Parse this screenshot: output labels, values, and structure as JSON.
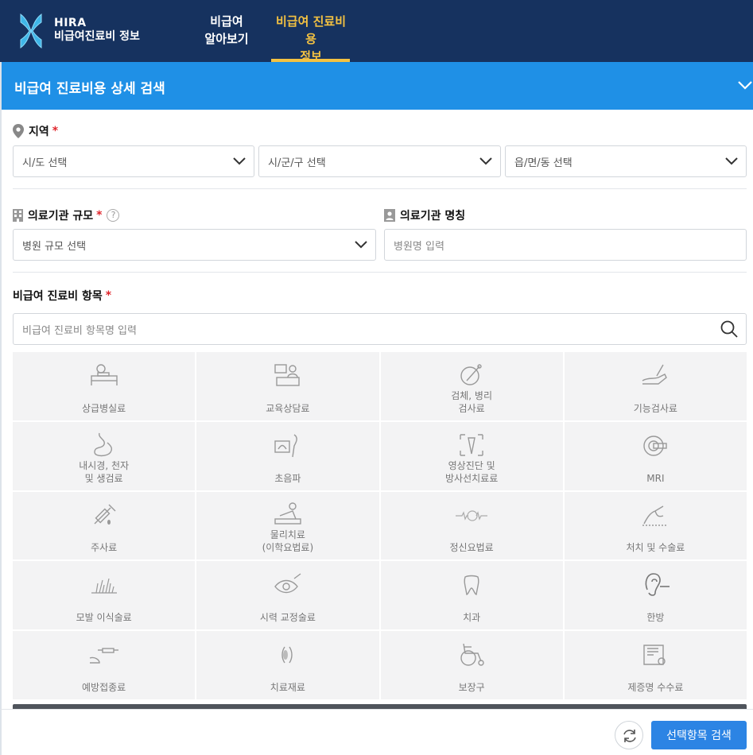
{
  "header": {
    "logo_line1": "HIRA",
    "logo_line2": "비급여진료비 정보",
    "nav": [
      {
        "label_line1": "비급여",
        "label_line2": "알아보기"
      },
      {
        "label_line1": "비급여 진료비용",
        "label_line2": "정보",
        "active": true
      }
    ]
  },
  "section": {
    "title": "비급여 진료비용 상세 검색",
    "icon": "chevron-down-icon"
  },
  "region": {
    "label": "지역",
    "required_mark": "*",
    "icon": "map-pin-icon",
    "selects": [
      "시/도 선택",
      "시/군/구 선택",
      "읍/면/동 선택"
    ]
  },
  "hospital_scale": {
    "label": "의료기관 규모",
    "required_mark": "*",
    "help": "?",
    "select": "병원 규모 선택"
  },
  "hospital_name": {
    "label": "의료기관 명칭",
    "placeholder": "병원명 입력"
  },
  "item_search": {
    "label": "비급여 진료비 항목",
    "required_mark": "*",
    "placeholder": "비급여 진료비 항목명 입력"
  },
  "categories": [
    {
      "label": "상급병실료",
      "icon": "hospital-bed-icon"
    },
    {
      "label": "교육상담료",
      "icon": "counseling-icon"
    },
    {
      "label": "검체, 병리\n검사료",
      "icon": "specimen-test-icon"
    },
    {
      "label": "기능검사료",
      "icon": "function-test-icon"
    },
    {
      "label": "내시경, 천자\n및 생검료",
      "icon": "endoscope-icon"
    },
    {
      "label": "초음파",
      "icon": "ultrasound-icon"
    },
    {
      "label": "영상진단 및\n방사선치료료",
      "icon": "xray-icon"
    },
    {
      "label": "MRI",
      "icon": "mri-icon"
    },
    {
      "label": "주사료",
      "icon": "syringe-icon"
    },
    {
      "label": "물리치료\n(이학요법료)",
      "icon": "physical-therapy-icon"
    },
    {
      "label": "정신요법료",
      "icon": "brain-wave-icon"
    },
    {
      "label": "처치 및 수술료",
      "icon": "surgery-icon"
    },
    {
      "label": "모발 이식술료",
      "icon": "hair-transplant-icon"
    },
    {
      "label": "시력 교정술료",
      "icon": "eye-laser-icon"
    },
    {
      "label": "치과",
      "icon": "tooth-icon"
    },
    {
      "label": "한방",
      "icon": "ear-acupuncture-icon"
    },
    {
      "label": "예방접종료",
      "icon": "vaccine-icon"
    },
    {
      "label": "치료재료",
      "icon": "medical-material-icon"
    },
    {
      "label": "보장구",
      "icon": "wheelchair-icon"
    },
    {
      "label": "제증명 수수료",
      "icon": "certificate-icon"
    }
  ],
  "footer": {
    "reset_icon": "refresh-icon",
    "search_button": "선택항목 검색"
  },
  "colors": {
    "header_bg": "#16325f",
    "accent_yellow": "#f4c242",
    "section_blue": "#1f90e6",
    "button_blue": "#2c84e4",
    "required_red": "#e0262c"
  }
}
